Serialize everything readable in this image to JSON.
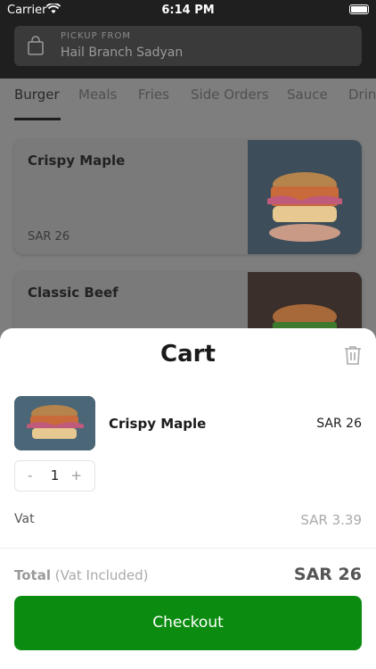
{
  "status_bar": {
    "carrier": "Carrier",
    "time": "6:14 PM"
  },
  "pickup": {
    "label": "PICKUP FROM",
    "branch": "Hail Branch Sadyan"
  },
  "tabs": [
    "Burger",
    "Meals",
    "Fries",
    "Side Orders",
    "Sauce",
    "Drinks"
  ],
  "products": [
    {
      "name": "Crispy Maple",
      "price": "SAR 26"
    },
    {
      "name": "Classic Beef"
    }
  ],
  "cart": {
    "title": "Cart",
    "item": {
      "name": "Crispy Maple",
      "price": "SAR 26",
      "quantity": "1",
      "minus": "-",
      "plus": "+"
    },
    "vat_label": "Vat",
    "vat_value": "SAR 3.39",
    "total_label": "Total",
    "total_note": "(Vat Included)",
    "total_value": "SAR 26",
    "checkout_label": "Checkout"
  },
  "colors": {
    "accent": "#0b8c10",
    "overlay": "#7e7e7e"
  }
}
